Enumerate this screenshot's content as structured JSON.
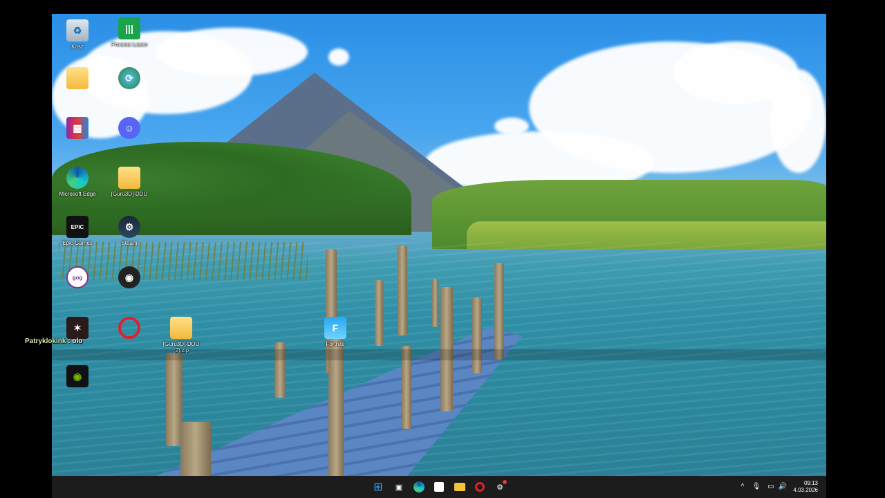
{
  "chat": {
    "user": "Patryklokink",
    "sep": " : ",
    "message": "olo"
  },
  "desktop_icons": [
    {
      "label": "Kosz"
    },
    {
      "label": "Process Lasso"
    },
    {
      "label": ""
    },
    {
      "label": ""
    },
    {
      "label": ""
    },
    {
      "label": ""
    },
    {
      "label": "Microsoft Edge"
    },
    {
      "label": "[Guru3D]-DDU"
    },
    {
      "label": "Epic Games"
    },
    {
      "label": "Steam"
    },
    {
      "label": ""
    },
    {
      "label": ""
    },
    {
      "label": ""
    },
    {
      "label": ""
    },
    {
      "label": "[Guru3D]-DDU (2).zip"
    },
    {
      "label": "Fortnite"
    },
    {
      "label": ""
    }
  ],
  "taskbar": {
    "time": "09:13",
    "date": "4.03.2026"
  },
  "colors": {
    "taskbar": "#1c1c1c",
    "sky": "#2a8fe6",
    "water": "#2f8fa6"
  }
}
